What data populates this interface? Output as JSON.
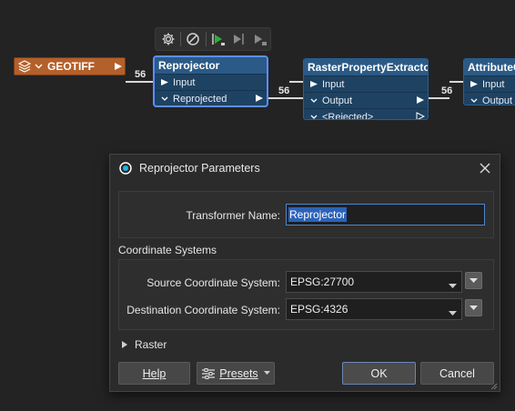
{
  "canvas": {
    "toolbar": {
      "icons": [
        "gear-icon",
        "disable-icon",
        "run-to-icon",
        "run-from-icon",
        "run-selected-icon"
      ]
    },
    "reader": {
      "name": "GEOTIFF"
    },
    "counts": [
      "56",
      "56",
      "56"
    ],
    "nodes": [
      {
        "title": "Reprojector",
        "input": "Input",
        "outputs": [
          "Reprojected"
        ]
      },
      {
        "title": "RasterPropertyExtractor",
        "input": "Input",
        "outputs": [
          "Output",
          "<Rejected>"
        ]
      },
      {
        "title": "AttributeCr",
        "input": "Input",
        "outputs": [
          "Output"
        ]
      }
    ]
  },
  "dialog": {
    "title": "Reprojector Parameters",
    "transformer_name_label": "Transformer Name:",
    "transformer_name_value": "Reprojector",
    "coord_section": "Coordinate Systems",
    "source_label": "Source Coordinate System:",
    "source_value": "EPSG:27700",
    "dest_label": "Destination Coordinate System:",
    "dest_value": "EPSG:4326",
    "raster_section": "Raster",
    "help_button": "Help",
    "presets_button": "Presets",
    "ok_button": "OK",
    "cancel_button": "Cancel",
    "colors": {
      "accent": "#4b87d0",
      "node_header": "#2b5a86",
      "reader": "#b4602b",
      "selected_border": "#5d8eff"
    }
  }
}
